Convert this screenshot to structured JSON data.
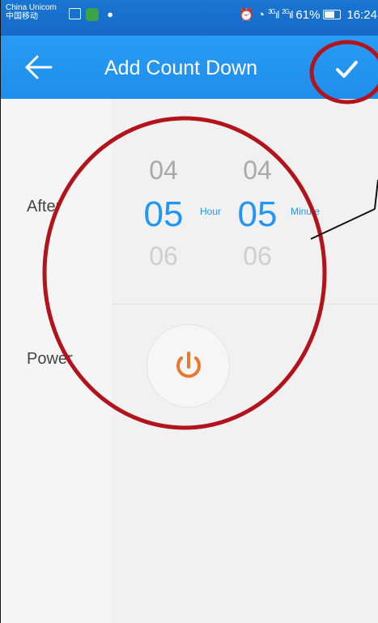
{
  "status_bar": {
    "carrier_primary": "China Unicom",
    "carrier_secondary": "中国移动",
    "net_3g": "3G",
    "net_2g": "2G",
    "battery_percent": "61%",
    "time": "16:24"
  },
  "toolbar": {
    "title": "Add Count Down",
    "back_icon": "arrow-left-icon",
    "confirm_icon": "check-icon"
  },
  "after_row": {
    "label": "After",
    "hour_picker": {
      "prev": "04",
      "current": "05",
      "next": "06",
      "unit": "Hour"
    },
    "minute_picker": {
      "prev": "04",
      "current": "05",
      "next": "06",
      "unit": "Minute"
    }
  },
  "power_row": {
    "label": "Power",
    "icon": "power-icon",
    "icon_color": "#e9772e"
  },
  "colors": {
    "accent": "#2196f3",
    "annotation": "#b3131b"
  }
}
